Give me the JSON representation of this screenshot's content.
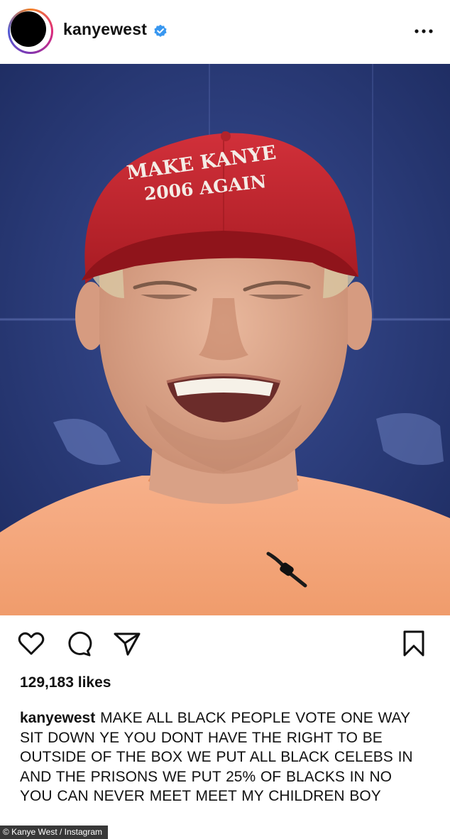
{
  "post": {
    "username": "kanyewest",
    "likes": "129,183 likes",
    "caption_username": "kanyewest",
    "caption_text": "MAKE ALL BLACK PEOPLE VOTE ONE WAY  SIT DOWN YE  YOU DONT HAVE THE RIGHT TO BE OUTSIDE OF THE BOX WE PUT ALL BLACK CELEBS IN AND THE PRISONS WE PUT 25% OF BLACKS IN  NO YOU CAN NEVER MEET MEET MY CHILDREN BOY",
    "image_hat_text": "MAKE KANYE 2006 AGAIN"
  },
  "credit": "© Kanye West / Instagram",
  "icons": {
    "verified": "verified-badge-icon",
    "more": "more-options-icon",
    "like": "heart-icon",
    "comment": "comment-icon",
    "share": "share-icon",
    "save": "bookmark-icon"
  },
  "colors": {
    "verified_blue": "#3897f0",
    "hat_red": "#c4232b",
    "shirt_orange": "#f4a478",
    "background_blue": "#23346e"
  }
}
